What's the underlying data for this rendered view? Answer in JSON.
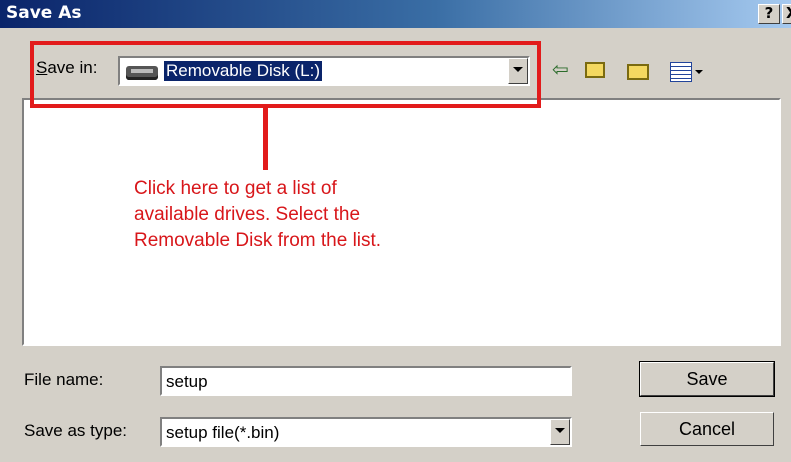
{
  "window": {
    "title": "Save As",
    "help_label": "?",
    "close_label": "X"
  },
  "save_in": {
    "label": "Save in:",
    "label_prefix": "S",
    "label_rest": "ave in:",
    "value": "Removable Disk (L:)"
  },
  "toolbar": {
    "icons": [
      "back-arrow-icon",
      "up-folder-icon",
      "new-folder-icon",
      "view-menu-icon"
    ]
  },
  "annotation": {
    "color": "#e21b1b",
    "lines": [
      "Click here to get a list of",
      "available drives. Select the",
      "Removable Disk from the list."
    ]
  },
  "file_name": {
    "label": "File name:",
    "value": "setup"
  },
  "save_as_type": {
    "label": "Save as type:",
    "value": "setup file(*.bin)"
  },
  "buttons": {
    "save": "Save",
    "cancel": "Cancel"
  }
}
